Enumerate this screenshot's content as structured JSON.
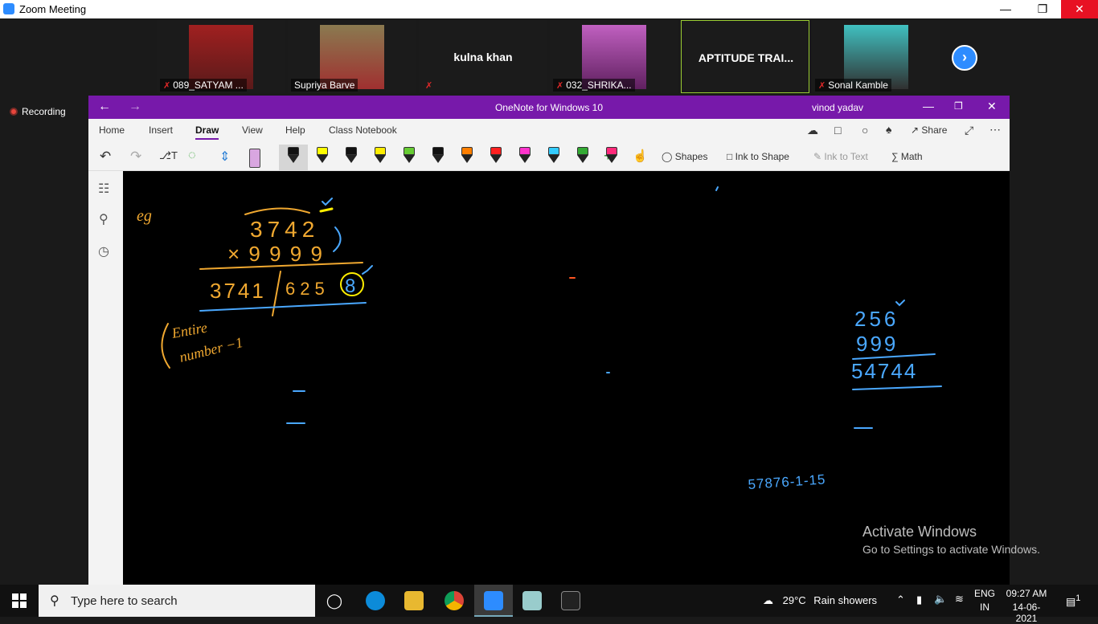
{
  "zoom": {
    "title": "Zoom Meeting",
    "recording": "Recording",
    "participants": [
      {
        "name": "089_SATYAM ...",
        "muted": true
      },
      {
        "name": "Supriya Barve",
        "muted": false
      },
      {
        "name": "kulna khan",
        "muted": true
      },
      {
        "name": "032_SHRIKA...",
        "muted": true
      },
      {
        "name": "APTITUDE TRAI...",
        "muted": false
      },
      {
        "name": "Sonal Kamble",
        "muted": true
      }
    ]
  },
  "onenote": {
    "title": "OneNote for Windows 10",
    "user": "vinod yadav",
    "tabs": [
      "Home",
      "Insert",
      "Draw",
      "View",
      "Help",
      "Class Notebook"
    ],
    "active_tab": "Draw",
    "share": "Share",
    "tools": {
      "shapes": "Shapes",
      "ink_to_shape": "Ink to Shape",
      "ink_to_text": "Ink to Text",
      "math": "Math"
    },
    "pen_colors": [
      "#111111",
      "#ffff00",
      "#111111",
      "#ffee00",
      "#66cc33",
      "#111111",
      "#ff7f00",
      "#ff2020",
      "#ff33cc",
      "#33ccff",
      "#33aa33",
      "#ff2a7a"
    ]
  },
  "ink": {
    "eg": "eg",
    "top_number": "3742",
    "multiplier": "× 9 9 9 9",
    "result_left": "3741",
    "result_mid": "625",
    "result_last": "8",
    "note_line1": "Entire",
    "note_line2": "number −1",
    "right_top": "256",
    "right_mult": "999",
    "right_result": "54744",
    "bottom_text": "57876-1-15"
  },
  "activate": {
    "title": "Activate Windows",
    "subtitle": "Go to Settings to activate Windows."
  },
  "taskbar": {
    "search_placeholder": "Type here to search",
    "weather_temp": "29°C",
    "weather_desc": "Rain showers",
    "lang1": "ENG",
    "lang2": "IN",
    "time": "09:27 AM",
    "date": "14-06-2021",
    "notifications": "1"
  }
}
